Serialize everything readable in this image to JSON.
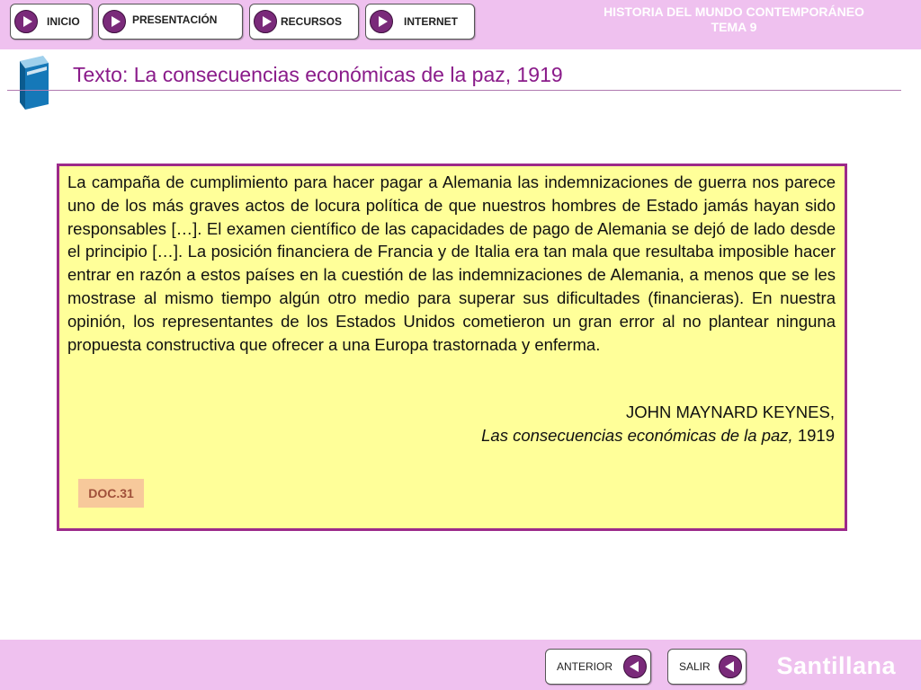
{
  "nav": {
    "inicio": "INICIO",
    "presentacion": "PRESENTACIÓN",
    "recursos": "RECURSOS",
    "internet": "INTERNET"
  },
  "header": {
    "line1": "HISTORIA DEL MUNDO CONTEMPORÁNEO",
    "line2": "TEMA 9"
  },
  "page": {
    "title": "Texto: La consecuencias económicas de la paz, 1919"
  },
  "document": {
    "body": "La campaña de cumplimiento para hacer pagar a Alemania las indemnizaciones de guerra nos parece uno de los más graves actos de locura política de que nuestros hombres de Estado jamás hayan sido responsables […]. El examen científico de las capacidades de pago de Alemania se dejó de lado desde el principio […]. La posición financiera de Francia y de Italia era tan mala que resultaba imposible hacer entrar en razón a estos países en la cuestión de las indemnizaciones de Alemania, a menos que se les mostrase al mismo tiempo algún otro medio para superar sus dificultades (financieras). En nuestra opinión, los representantes de los Estados Unidos cometieron un gran error al no plantear ninguna propuesta constructiva que ofrecer a una Europa trastornada y enferma.",
    "author": "JOHN MAYNARD KEYNES,",
    "source_work": "Las consecuencias económicas de la paz,",
    "source_year": "1919",
    "tag": "DOC.31"
  },
  "footer": {
    "anterior": "ANTERIOR",
    "salir": "SALIR",
    "brand": "Santillana"
  },
  "icons": {
    "nav_play": "play-icon",
    "footer_back": "back-arrow-icon",
    "title": "book-icon"
  },
  "colors": {
    "bars": "#efc1ef",
    "accent": "#8a1b8a",
    "panel_bg": "#ffff99",
    "panel_border": "#9c2a8a",
    "tag_bg": "#f7c99b"
  }
}
